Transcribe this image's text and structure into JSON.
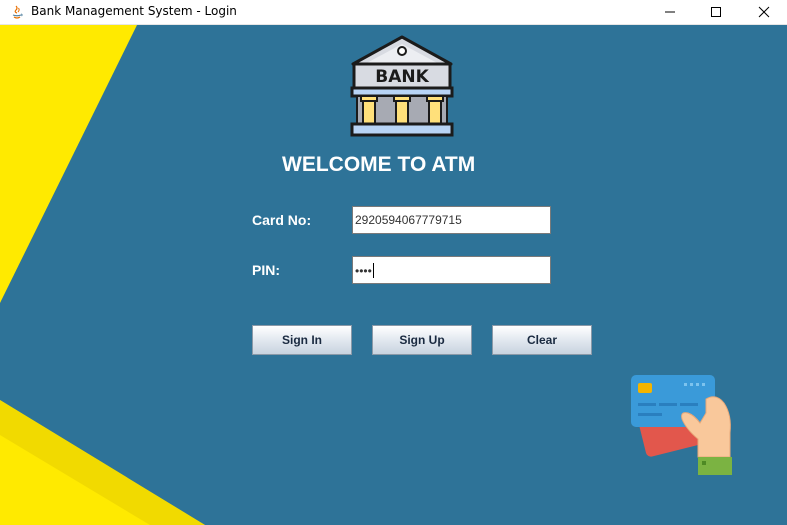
{
  "window": {
    "title": "Bank Management System - Login"
  },
  "logo": {
    "text": "BANK"
  },
  "login": {
    "heading": "WELCOME TO ATM",
    "card_label": "Card No:",
    "card_value": "2920594067779715",
    "pin_label": "PIN:",
    "pin_masked": "••••"
  },
  "buttons": {
    "sign_in": "Sign In",
    "sign_up": "Sign Up",
    "clear": "Clear"
  },
  "colors": {
    "background": "#2e7398",
    "accent_yellow": "#ffea00",
    "text": "#ffffff"
  },
  "icons": [
    "java-app-icon",
    "bank-building-icon",
    "credit-card-hand-icon",
    "minimize-icon",
    "maximize-icon",
    "close-icon"
  ]
}
